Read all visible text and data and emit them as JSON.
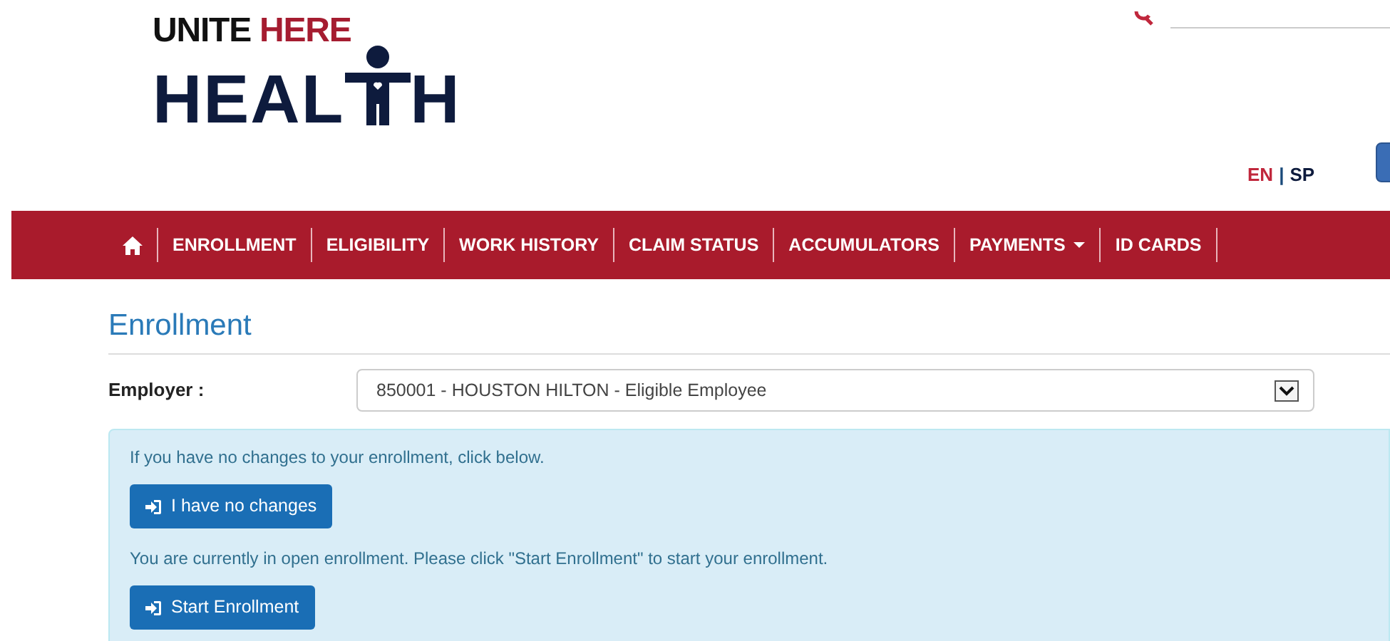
{
  "logo": {
    "top_words": [
      "UNITE",
      "HERE"
    ],
    "bottom_start": "HEAL",
    "bottom_end": "H"
  },
  "languages": [
    {
      "label": "EN",
      "selected": true
    },
    {
      "label": "SP",
      "selected": false
    }
  ],
  "language_separator": "|",
  "nav": [
    {
      "kind": "home"
    },
    {
      "kind": "link",
      "label": "ENROLLMENT"
    },
    {
      "kind": "link",
      "label": "ELIGIBILITY"
    },
    {
      "kind": "link",
      "label": "WORK HISTORY"
    },
    {
      "kind": "link",
      "label": "CLAIM STATUS"
    },
    {
      "kind": "link",
      "label": "ACCUMULATORS"
    },
    {
      "kind": "dropdown",
      "label": "PAYMENTS"
    },
    {
      "kind": "link",
      "label": "ID CARDS"
    }
  ],
  "page_title": "Enrollment",
  "employer": {
    "label": "Employer :",
    "value": "850001 - HOUSTON HILTON - Eligible Employee"
  },
  "info": [
    {
      "text": "If you have no changes to your enrollment, click below.",
      "button": "I have no changes"
    },
    {
      "text": "You are currently in open enrollment. Please click \"Start Enrollment\" to start your enrollment.",
      "button": "Start Enrollment"
    }
  ]
}
